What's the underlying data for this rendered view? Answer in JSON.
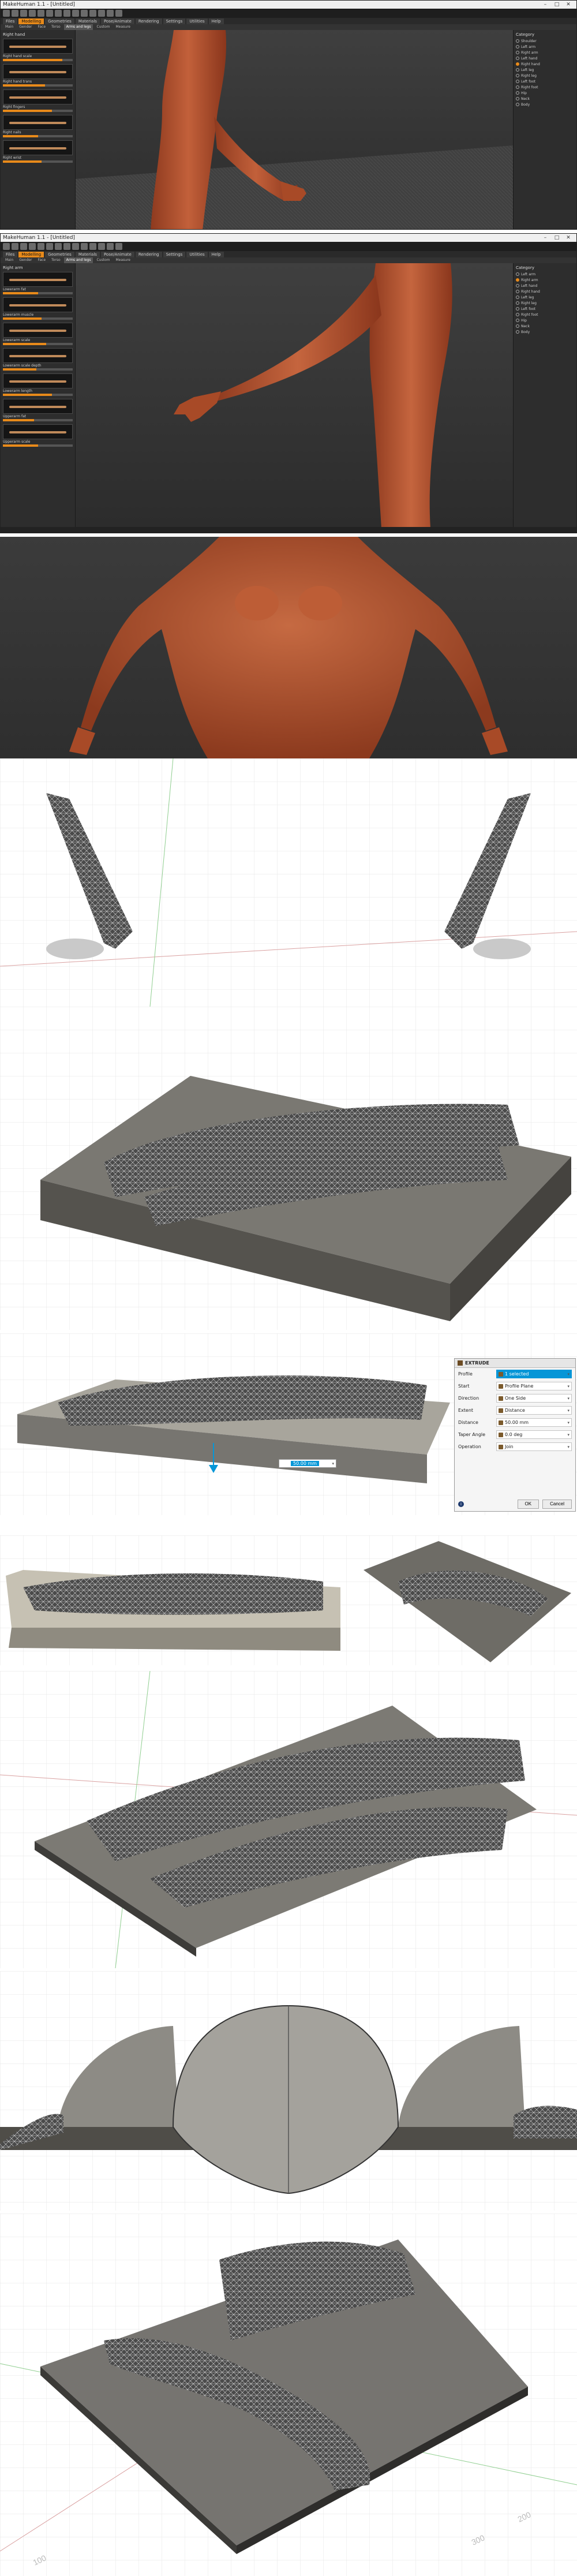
{
  "mh1": {
    "window_title": "MakeHuman 1.1 - [Untitled]",
    "tabs": [
      "Files",
      "Modelling",
      "Geometries",
      "Materials",
      "Pose/Animate",
      "Rendering",
      "Settings",
      "Utilities",
      "Help"
    ],
    "active_tab": "Modelling",
    "subtabs": [
      "Main",
      "Gender",
      "Face",
      "Torso",
      "Arms and legs",
      "Custom",
      "Measure"
    ],
    "active_subtab": "Arms and legs",
    "left_group": "Right hand",
    "sliders": [
      {
        "label": "Right hand scale",
        "value": 0.85
      },
      {
        "label": "Right hand trans",
        "value": 0.6
      },
      {
        "label": "Right fingers",
        "value": 0.7
      },
      {
        "label": "Right nails",
        "value": 0.5
      },
      {
        "label": "Right wrist",
        "value": 0.55
      }
    ],
    "right_group": "Category",
    "right_options": [
      "Shoulder",
      "Left arm",
      "Right arm",
      "Left hand",
      "Right hand",
      "Left leg",
      "Right leg",
      "Left foot",
      "Right foot",
      "Hip",
      "Neck",
      "Body"
    ],
    "right_active": 4
  },
  "mh2": {
    "window_title": "MakeHuman 1.1 - [Untitled]",
    "tabs": [
      "Files",
      "Modelling",
      "Geometries",
      "Materials",
      "Pose/Animate",
      "Rendering",
      "Settings",
      "Utilities",
      "Help"
    ],
    "active_tab": "Modelling",
    "subtabs": [
      "Main",
      "Gender",
      "Face",
      "Torso",
      "Arms and legs",
      "Custom",
      "Measure"
    ],
    "active_subtab": "Arms and legs",
    "left_group": "Right arm",
    "sliders": [
      {
        "label": "Lowerarm fat",
        "value": 0.5
      },
      {
        "label": "Lowerarm muscle",
        "value": 0.55
      },
      {
        "label": "Lowerarm scale",
        "value": 0.62
      },
      {
        "label": "Lowerarm scale depth",
        "value": 0.48
      },
      {
        "label": "Lowerarm length",
        "value": 0.7
      },
      {
        "label": "Upperarm fat",
        "value": 0.45
      },
      {
        "label": "Upperarm scale",
        "value": 0.5
      }
    ],
    "right_group": "Category",
    "right_options": [
      "Left arm",
      "Right arm",
      "Left hand",
      "Right hand",
      "Left leg",
      "Right leg",
      "Left foot",
      "Right foot",
      "Hip",
      "Neck",
      "Body"
    ],
    "right_active": 1
  },
  "extrude_dialog": {
    "title": "EXTRUDE",
    "rows": [
      {
        "label": "Profile",
        "value": "1 selected",
        "selected": true
      },
      {
        "label": "Start",
        "value": "Profile Plane",
        "selected": false
      },
      {
        "label": "Direction",
        "value": "One Side",
        "selected": false
      },
      {
        "label": "Extent",
        "value": "Distance",
        "selected": false
      },
      {
        "label": "Distance",
        "value": "50.00 mm",
        "selected": false
      },
      {
        "label": "Taper Angle",
        "value": "0.0 deg",
        "selected": false
      },
      {
        "label": "Operation",
        "value": "Join",
        "selected": false
      }
    ],
    "ok": "OK",
    "cancel": "Cancel"
  },
  "distance_input": "50.00 mm",
  "axis_labels": [
    "300",
    "200",
    "100"
  ],
  "colors": {
    "skin": "#b4532f",
    "orange_accent": "#e88a1a",
    "fusion_blue": "#0696d7",
    "mold_grey": "#6e6c66",
    "mesh_dark": "#2b2b2b"
  }
}
